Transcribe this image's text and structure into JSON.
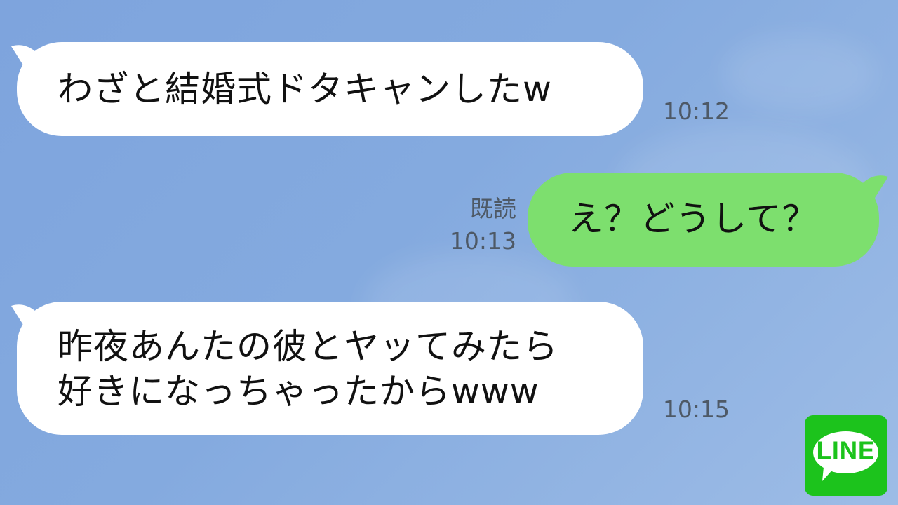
{
  "chat": {
    "messages": [
      {
        "side": "incoming",
        "lines": [
          "わざと結婚式ドタキャンしたw"
        ],
        "time": "10:12"
      },
      {
        "side": "outgoing",
        "lines": [
          "え？どうして？"
        ],
        "read_label": "既読",
        "time": "10:13"
      },
      {
        "side": "incoming",
        "lines": [
          "昨夜あんたの彼とヤッてみたら",
          "好きになっちゃったからwww"
        ],
        "time": "10:15"
      }
    ]
  },
  "branding": {
    "logo_text": "LINE",
    "logo_icon": "line-logo-icon"
  },
  "colors": {
    "background": "#84aadf",
    "incoming_bubble": "#ffffff",
    "outgoing_bubble": "#7ddf6e",
    "timestamp_text": "#4e5966",
    "brand_green": "#1cc31c"
  }
}
